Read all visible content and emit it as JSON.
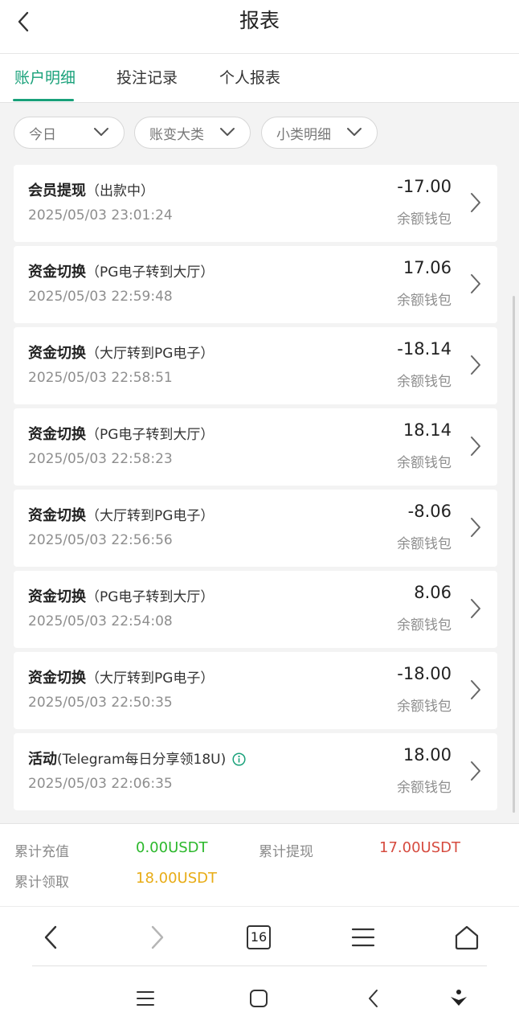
{
  "header": {
    "title": "报表"
  },
  "tabs": [
    {
      "label": "账户明细",
      "active": true
    },
    {
      "label": "投注记录",
      "active": false
    },
    {
      "label": "个人报表",
      "active": false
    }
  ],
  "filters": [
    {
      "label": "今日"
    },
    {
      "label": "账变大类"
    },
    {
      "label": "小类明细"
    }
  ],
  "records": [
    {
      "type": "会员提现",
      "detail": "（出款中）",
      "time": "2025/05/03 23:01:24",
      "amount": "-17.00",
      "wallet": "余额钱包"
    },
    {
      "type": "资金切换",
      "detail": "（PG电子转到大厅）",
      "time": "2025/05/03 22:59:48",
      "amount": "17.06",
      "wallet": "余额钱包"
    },
    {
      "type": "资金切换",
      "detail": "（大厅转到PG电子）",
      "time": "2025/05/03 22:58:51",
      "amount": "-18.14",
      "wallet": "余额钱包"
    },
    {
      "type": "资金切换",
      "detail": "（PG电子转到大厅）",
      "time": "2025/05/03 22:58:23",
      "amount": "18.14",
      "wallet": "余额钱包"
    },
    {
      "type": "资金切换",
      "detail": "（大厅转到PG电子）",
      "time": "2025/05/03 22:56:56",
      "amount": "-8.06",
      "wallet": "余额钱包"
    },
    {
      "type": "资金切换",
      "detail": "（PG电子转到大厅）",
      "time": "2025/05/03 22:54:08",
      "amount": "8.06",
      "wallet": "余额钱包"
    },
    {
      "type": "资金切换",
      "detail": "（大厅转到PG电子）",
      "time": "2025/05/03 22:50:35",
      "amount": "-18.00",
      "wallet": "余额钱包"
    },
    {
      "type": "活动",
      "detail": "(Telegram每日分享领18U)",
      "time": "2025/05/03 22:06:35",
      "amount": "18.00",
      "wallet": "余额钱包",
      "info_icon": "info-icon"
    }
  ],
  "summary": {
    "recharge_label": "累计充值",
    "recharge_value": "0.00USDT",
    "withdraw_label": "累计提现",
    "withdraw_value": "17.00USDT",
    "claim_label": "累计领取",
    "claim_value": "18.00USDT"
  },
  "browser": {
    "tab_count": "16"
  },
  "colors": {
    "accent": "#19a17a",
    "recharge": "#2cb82c",
    "withdraw": "#d64b3f",
    "claim": "#e8ac16"
  }
}
